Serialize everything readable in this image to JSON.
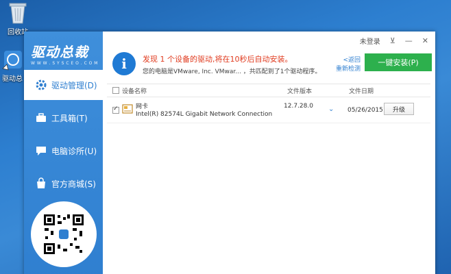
{
  "desktop": {
    "recycle_label": "回收站",
    "app_label": "驱动总"
  },
  "app": {
    "logo_text": "驱动总裁",
    "logo_url": "W W W . S Y S C E O . C O M",
    "colors": {
      "accent": "#2f7fd0",
      "install": "#2db04d",
      "alert": "#e03a1e"
    }
  },
  "topbar": {
    "login": "未登录",
    "pin": "⊻",
    "minimize": "—",
    "close": "✕"
  },
  "sidebar": {
    "items": [
      {
        "label": "驱动管理(D)",
        "icon": "gear-icon",
        "active": true
      },
      {
        "label": "工具箱(T)",
        "icon": "toolbox-icon",
        "active": false
      },
      {
        "label": "电脑诊所(U)",
        "icon": "chat-icon",
        "active": false
      },
      {
        "label": "官方商城(S)",
        "icon": "bag-icon",
        "active": false
      }
    ]
  },
  "banner": {
    "title": "发现 1 个设备的驱动,将在10秒后自动安装。",
    "subtitle": "您的电脑是VMware, Inc. VMwar... ，共匹配到了1个驱动程序。",
    "back_line1": "<返回",
    "back_line2": "重新检测",
    "install_label": "一键安装(P)"
  },
  "table": {
    "headers": {
      "name": "设备名称",
      "version": "文件版本",
      "date": "文件日期"
    },
    "rows": [
      {
        "type": "网卡",
        "name": "Intel(R) 82574L Gigabit Network Connection",
        "version": "12.7.28.0",
        "date": "05/26/2015",
        "action": "升级",
        "checked": true
      }
    ]
  }
}
